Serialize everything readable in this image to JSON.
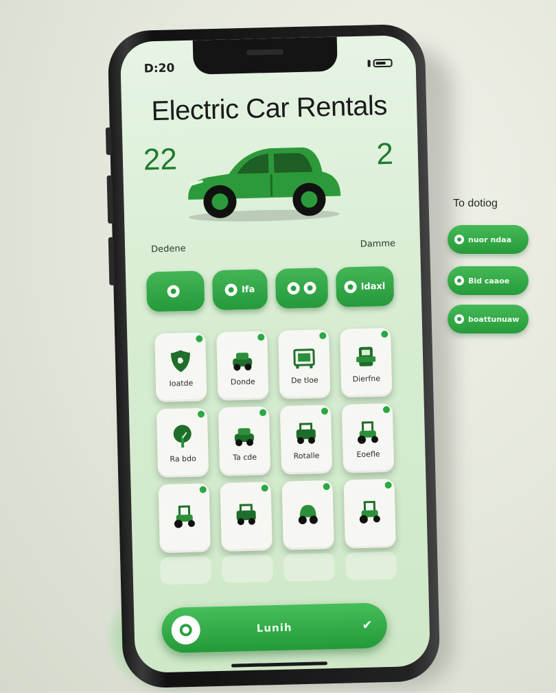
{
  "status": {
    "time": "D:20"
  },
  "header": {
    "title": "Electric Car Rentals",
    "stat_left": "22",
    "stat_right": "2"
  },
  "labels": {
    "left": "Dedene",
    "right": "Damme"
  },
  "chips": [
    {
      "label": "",
      "icon": "leaf-icon"
    },
    {
      "label": "Ifa",
      "icon": "pin-icon"
    },
    {
      "label": "",
      "icon": "toggle-icon"
    },
    {
      "label": "ldaxl",
      "icon": "plug-icon"
    }
  ],
  "tiles": [
    {
      "label": "Ioatde",
      "icon": "shield-icon"
    },
    {
      "label": "Donde",
      "icon": "car-icon"
    },
    {
      "label": "De tloe",
      "icon": "charger-icon"
    },
    {
      "label": "Dierfne",
      "icon": "station-icon"
    },
    {
      "label": "Ra bdo",
      "icon": "tree-icon"
    },
    {
      "label": "Ta cde",
      "icon": "car-icon"
    },
    {
      "label": "Rotalle",
      "icon": "jeep-icon"
    },
    {
      "label": "Eoefle",
      "icon": "tractor-icon"
    },
    {
      "label": "",
      "icon": "tractor-icon"
    },
    {
      "label": "",
      "icon": "jeep-icon"
    },
    {
      "label": "",
      "icon": "buggy-icon"
    },
    {
      "label": "",
      "icon": "tractor-icon"
    }
  ],
  "bottom_button": {
    "label": "Lunih"
  },
  "side_panel": {
    "title": "To dotiog",
    "items": [
      {
        "label": "nuor ndaa"
      },
      {
        "label": "Bid caaoe"
      },
      {
        "label": "boattunuaw"
      }
    ]
  },
  "colors": {
    "accent": "#2aa040",
    "screen_bg": "#d8edd3",
    "tile_bg": "#f6f7f2"
  }
}
